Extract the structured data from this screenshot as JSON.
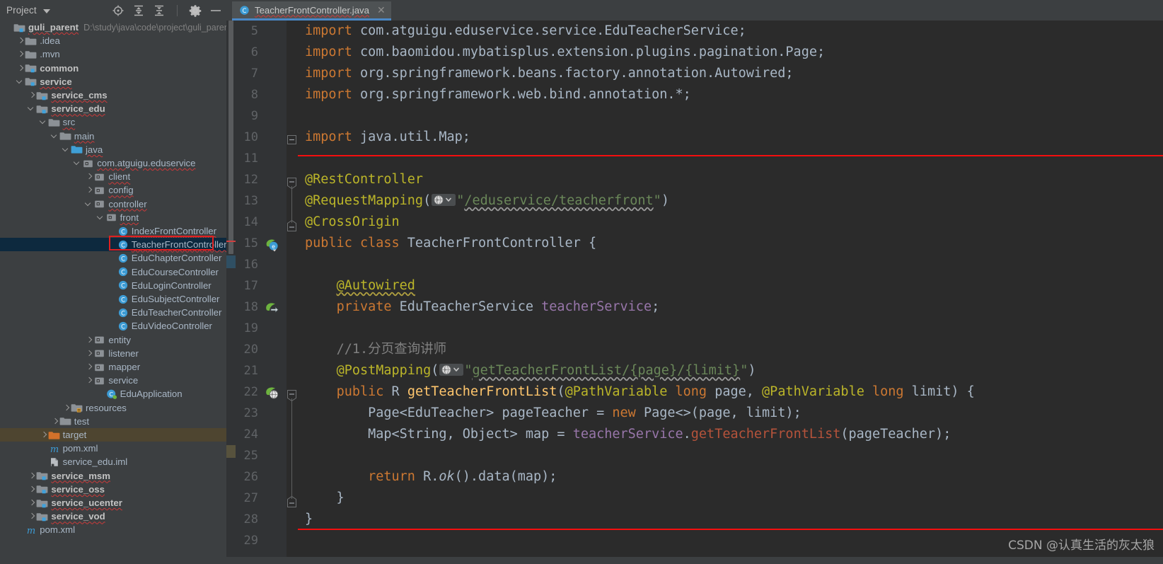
{
  "project_panel": {
    "title": "Project",
    "title_caret_icon": "chevron-down-icon",
    "toolbar_icons": [
      {
        "name": "locate-target-icon",
        "label": "Select Opened File"
      },
      {
        "name": "expand-all-icon",
        "label": "Expand All"
      },
      {
        "name": "collapse-all-icon",
        "label": "Collapse All"
      },
      {
        "name": "gear-icon",
        "label": "Settings"
      },
      {
        "name": "minimize-icon",
        "label": "Hide"
      }
    ],
    "tree": [
      {
        "label": "guli_parent",
        "path": "D:\\study\\java\\code\\project\\guli_parent",
        "indent": 0,
        "twisty": "none",
        "icon": "module-icon",
        "bold": true,
        "wavy": true
      },
      {
        "label": ".idea",
        "indent": 1,
        "twisty": "closed",
        "icon": "folder-icon"
      },
      {
        "label": ".mvn",
        "indent": 1,
        "twisty": "closed",
        "icon": "folder-icon"
      },
      {
        "label": "common",
        "indent": 1,
        "twisty": "closed",
        "icon": "module-icon",
        "bold": true
      },
      {
        "label": "service",
        "indent": 1,
        "twisty": "open",
        "icon": "module-icon",
        "bold": true,
        "wavy": true
      },
      {
        "label": "service_cms",
        "indent": 2,
        "twisty": "closed",
        "icon": "module-icon",
        "bold": true,
        "wavy": true
      },
      {
        "label": "service_edu",
        "indent": 2,
        "twisty": "open",
        "icon": "module-icon",
        "bold": true,
        "wavy": true
      },
      {
        "label": "src",
        "indent": 3,
        "twisty": "open",
        "icon": "folder-icon",
        "wavy": true
      },
      {
        "label": "main",
        "indent": 4,
        "twisty": "open",
        "icon": "folder-icon",
        "wavy": true
      },
      {
        "label": "java",
        "indent": 5,
        "twisty": "open",
        "icon": "source-folder-icon",
        "wavy": true
      },
      {
        "label": "com.atguigu.eduservice",
        "indent": 6,
        "twisty": "open",
        "icon": "package-icon",
        "wavy": true
      },
      {
        "label": "client",
        "indent": 7,
        "twisty": "closed",
        "icon": "package-icon",
        "wavy": true
      },
      {
        "label": "config",
        "indent": 7,
        "twisty": "closed",
        "icon": "package-icon",
        "wavy": true
      },
      {
        "label": "controller",
        "indent": 7,
        "twisty": "open",
        "icon": "package-icon",
        "wavy": true
      },
      {
        "label": "front",
        "indent": 8,
        "twisty": "open",
        "icon": "package-icon",
        "wavy": true
      },
      {
        "label": "IndexFrontController",
        "indent": 9,
        "twisty": "none",
        "icon": "java-class-icon",
        "wavy": true
      },
      {
        "label": "TeacherFrontController",
        "indent": 9,
        "twisty": "none",
        "icon": "java-class-icon",
        "selected": "blue",
        "wavy": true
      },
      {
        "label": "EduChapterController",
        "indent": 9,
        "twisty": "none",
        "icon": "java-class-icon"
      },
      {
        "label": "EduCourseController",
        "indent": 9,
        "twisty": "none",
        "icon": "java-class-icon"
      },
      {
        "label": "EduLoginController",
        "indent": 9,
        "twisty": "none",
        "icon": "java-class-icon"
      },
      {
        "label": "EduSubjectController",
        "indent": 9,
        "twisty": "none",
        "icon": "java-class-icon"
      },
      {
        "label": "EduTeacherController",
        "indent": 9,
        "twisty": "none",
        "icon": "java-class-icon"
      },
      {
        "label": "EduVideoController",
        "indent": 9,
        "twisty": "none",
        "icon": "java-class-icon"
      },
      {
        "label": "entity",
        "indent": 7,
        "twisty": "closed",
        "icon": "package-icon"
      },
      {
        "label": "listener",
        "indent": 7,
        "twisty": "closed",
        "icon": "package-icon"
      },
      {
        "label": "mapper",
        "indent": 7,
        "twisty": "closed",
        "icon": "package-icon"
      },
      {
        "label": "service",
        "indent": 7,
        "twisty": "closed",
        "icon": "package-icon"
      },
      {
        "label": "EduApplication",
        "indent": 8,
        "twisty": "none",
        "icon": "spring-boot-class-icon"
      },
      {
        "label": "resources",
        "indent": 5,
        "twisty": "closed",
        "icon": "resources-folder-icon"
      },
      {
        "label": "test",
        "indent": 4,
        "twisty": "closed",
        "icon": "folder-icon"
      },
      {
        "label": "target",
        "indent": 3,
        "twisty": "closed",
        "icon": "target-folder-icon",
        "selected": "brown"
      },
      {
        "label": "pom.xml",
        "indent": 3,
        "twisty": "none",
        "icon": "maven-icon"
      },
      {
        "label": "service_edu.iml",
        "indent": 3,
        "twisty": "none",
        "icon": "iml-icon"
      },
      {
        "label": "service_msm",
        "indent": 2,
        "twisty": "closed",
        "icon": "module-icon",
        "bold": true,
        "wavy": true
      },
      {
        "label": "service_oss",
        "indent": 2,
        "twisty": "closed",
        "icon": "module-icon",
        "bold": true,
        "wavy": true
      },
      {
        "label": "service_ucenter",
        "indent": 2,
        "twisty": "closed",
        "icon": "module-icon",
        "bold": true,
        "wavy": true
      },
      {
        "label": "service_vod",
        "indent": 2,
        "twisty": "closed",
        "icon": "module-icon",
        "bold": true,
        "wavy": true
      },
      {
        "label": "pom.xml",
        "indent": 1,
        "twisty": "none",
        "icon": "maven-icon"
      }
    ]
  },
  "editor": {
    "tab": {
      "label": "TeacherFrontController.java",
      "icon": "java-class-icon",
      "close_icon": "close-icon"
    },
    "first_line_number": 5,
    "last_line_number": 29,
    "gutter_icons": [
      {
        "line": 15,
        "name": "spring-bean-icon"
      },
      {
        "line": 18,
        "name": "spring-autowired-icon"
      },
      {
        "line": 22,
        "name": "spring-request-mapping-icon"
      }
    ],
    "lines": [
      {
        "n": 5,
        "text": "import com.atguigu.eduservice.service.EduTeacherService;"
      },
      {
        "n": 6,
        "text": "import com.baomidou.mybatisplus.extension.plugins.pagination.Page;"
      },
      {
        "n": 7,
        "text": "import org.springframework.beans.factory.annotation.Autowired;"
      },
      {
        "n": 8,
        "text": "import org.springframework.web.bind.annotation.*;"
      },
      {
        "n": 9,
        "text": ""
      },
      {
        "n": 10,
        "text": "import java.util.Map;"
      },
      {
        "n": 11,
        "text": ""
      },
      {
        "n": 12,
        "text": "@RestController"
      },
      {
        "n": 13,
        "text": "@RequestMapping(\"/eduservice/teacherfront\")"
      },
      {
        "n": 14,
        "text": "@CrossOrigin"
      },
      {
        "n": 15,
        "text": "public class TeacherFrontController {"
      },
      {
        "n": 16,
        "text": ""
      },
      {
        "n": 17,
        "text": "    @Autowired"
      },
      {
        "n": 18,
        "text": "    private EduTeacherService teacherService;"
      },
      {
        "n": 19,
        "text": ""
      },
      {
        "n": 20,
        "text": "    //1.分页查询讲师"
      },
      {
        "n": 21,
        "text": "    @PostMapping(\"getTeacherFrontList/{page}/{limit}\")"
      },
      {
        "n": 22,
        "text": "    public R getTeacherFrontList(@PathVariable long page, @PathVariable long limit) {"
      },
      {
        "n": 23,
        "text": "        Page<EduTeacher> pageTeacher = new Page<>(page, limit);"
      },
      {
        "n": 24,
        "text": "        Map<String, Object> map = teacherService.getTeacherFrontList(pageTeacher);"
      },
      {
        "n": 25,
        "text": ""
      },
      {
        "n": 26,
        "text": "        return R.ok().data(map);"
      },
      {
        "n": 27,
        "text": "    }"
      },
      {
        "n": 28,
        "text": "}"
      },
      {
        "n": 29,
        "text": ""
      }
    ]
  },
  "annotations": {
    "code_box_color": "#f40f0f",
    "tree_box_color": "#e02020"
  },
  "watermark": {
    "text": "CSDN @认真生活的灰太狼"
  },
  "colors": {
    "editor_bg": "#2b2b2b",
    "panel_bg": "#3c3f41",
    "gutter_bg": "#313335",
    "keyword": "#cc7832",
    "annotation": "#bbb529",
    "string": "#6a8759",
    "comment": "#808080",
    "field": "#9876aa",
    "method": "#ffc66d",
    "default_text": "#a9b7c6",
    "selection_blue": "#0d293e",
    "selection_brown": "#4e4530",
    "tab_underline": "#4a88c7"
  }
}
